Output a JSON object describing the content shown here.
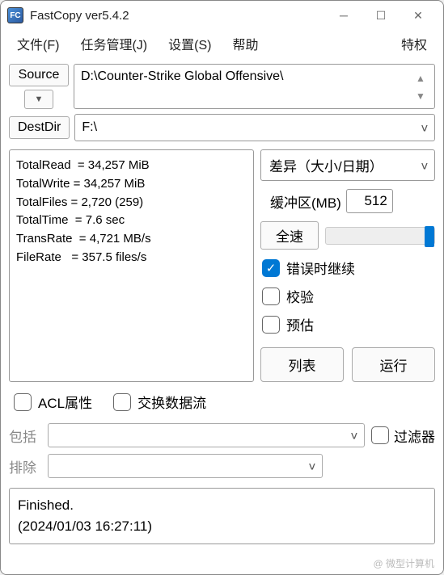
{
  "titlebar": {
    "icon_text": "FC",
    "title": "FastCopy ver5.4.2"
  },
  "menu": {
    "file": "文件(F)",
    "jobs": "任务管理(J)",
    "settings": "设置(S)",
    "help": "帮助",
    "priv": "特权"
  },
  "source": {
    "btn": "Source",
    "path": "D:\\Counter-Strike Global Offensive\\"
  },
  "dest": {
    "btn": "DestDir",
    "path": "F:\\"
  },
  "stats": {
    "read": "TotalRead  = 34,257 MiB",
    "write": "TotalWrite = 34,257 MiB",
    "files": "TotalFiles = 2,720 (259)",
    "time": "TotalTime  = 7.6 sec",
    "rate": "TransRate  = 4,721 MB/s",
    "frate": "FileRate   = 357.5 files/s"
  },
  "mode": {
    "selected": "差异（大小/日期）"
  },
  "buffer": {
    "label": "缓冲区(MB)",
    "value": "512"
  },
  "speed": {
    "btn": "全速"
  },
  "checks": {
    "cont_err": "错误时继续",
    "verify": "校验",
    "estimate": "预估"
  },
  "actions": {
    "list": "列表",
    "run": "运行"
  },
  "lower": {
    "acl": "ACL属性",
    "altstream": "交换数据流"
  },
  "filters": {
    "include_label": "包括",
    "exclude_label": "排除",
    "toggle": "过滤器"
  },
  "status": {
    "line1": "Finished.",
    "line2": "(2024/01/03 16:27:11)"
  },
  "watermark": "@ 微型计算机"
}
